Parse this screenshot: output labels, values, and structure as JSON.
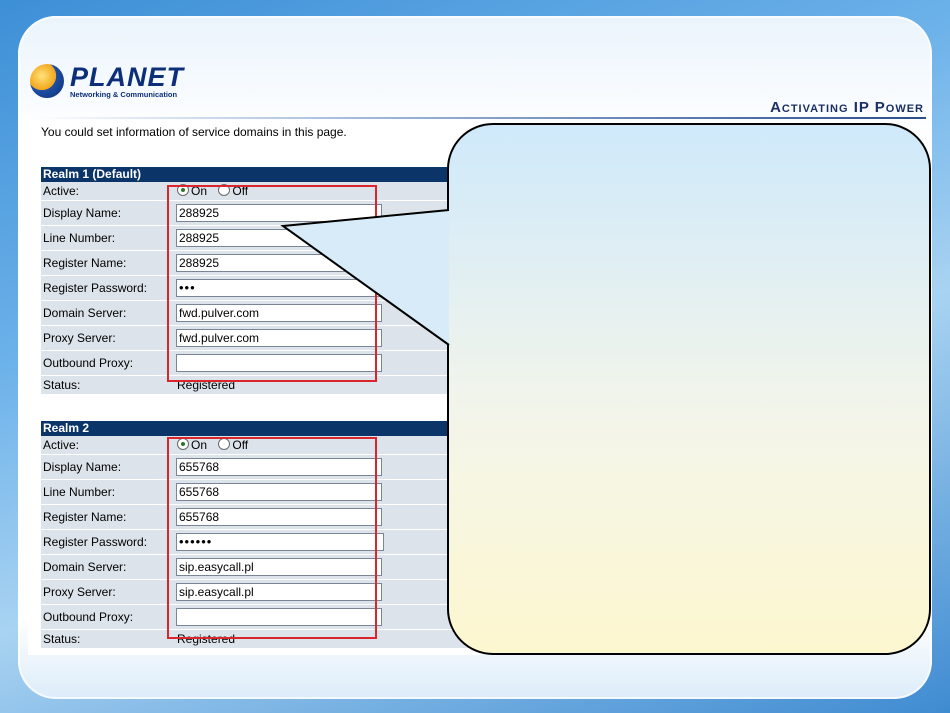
{
  "brand": {
    "logo_word": "PLANET",
    "logo_tagline": "Networking & Communication",
    "slide_heading": "Activating IP Power"
  },
  "page": {
    "intro": "You could set information of service domains in this page."
  },
  "realms": [
    {
      "title": "Realm 1 (Default)",
      "labels": {
        "active": "Active:",
        "display_name": "Display Name:",
        "line_number": "Line Number:",
        "register_name": "Register Name:",
        "register_password": "Register Password:",
        "domain_server": "Domain Server:",
        "proxy_server": "Proxy Server:",
        "outbound_proxy": "Outbound Proxy:",
        "status": "Status:"
      },
      "active_options": [
        "On",
        "Off"
      ],
      "active_selected": "On",
      "display_name": "288925",
      "line_number": "288925",
      "register_name": "288925",
      "register_password": "•••",
      "domain_server": "fwd.pulver.com",
      "proxy_server": "fwd.pulver.com",
      "outbound_proxy": "",
      "status": "Registered"
    },
    {
      "title": "Realm 2",
      "labels": {
        "active": "Active:",
        "display_name": "Display Name:",
        "line_number": "Line Number:",
        "register_name": "Register Name:",
        "register_password": "Register Password:",
        "domain_server": "Domain Server:",
        "proxy_server": "Proxy Server:",
        "outbound_proxy": "Outbound Proxy:",
        "status": "Status:"
      },
      "active_options": [
        "On",
        "Off"
      ],
      "active_selected": "On",
      "display_name": "655768",
      "line_number": "655768",
      "register_name": "655768",
      "register_password": "••••••",
      "domain_server": "sip.easycall.pl",
      "proxy_server": "sip.easycall.pl",
      "outbound_proxy": "",
      "status": "Registered"
    }
  ],
  "colors": {
    "realm_header_bg": "#0b3469",
    "row_bg": "#dde3ea",
    "highlight": "#d9262c",
    "callout_top": "#cfe9fb",
    "callout_bottom": "#fdf7cf"
  }
}
